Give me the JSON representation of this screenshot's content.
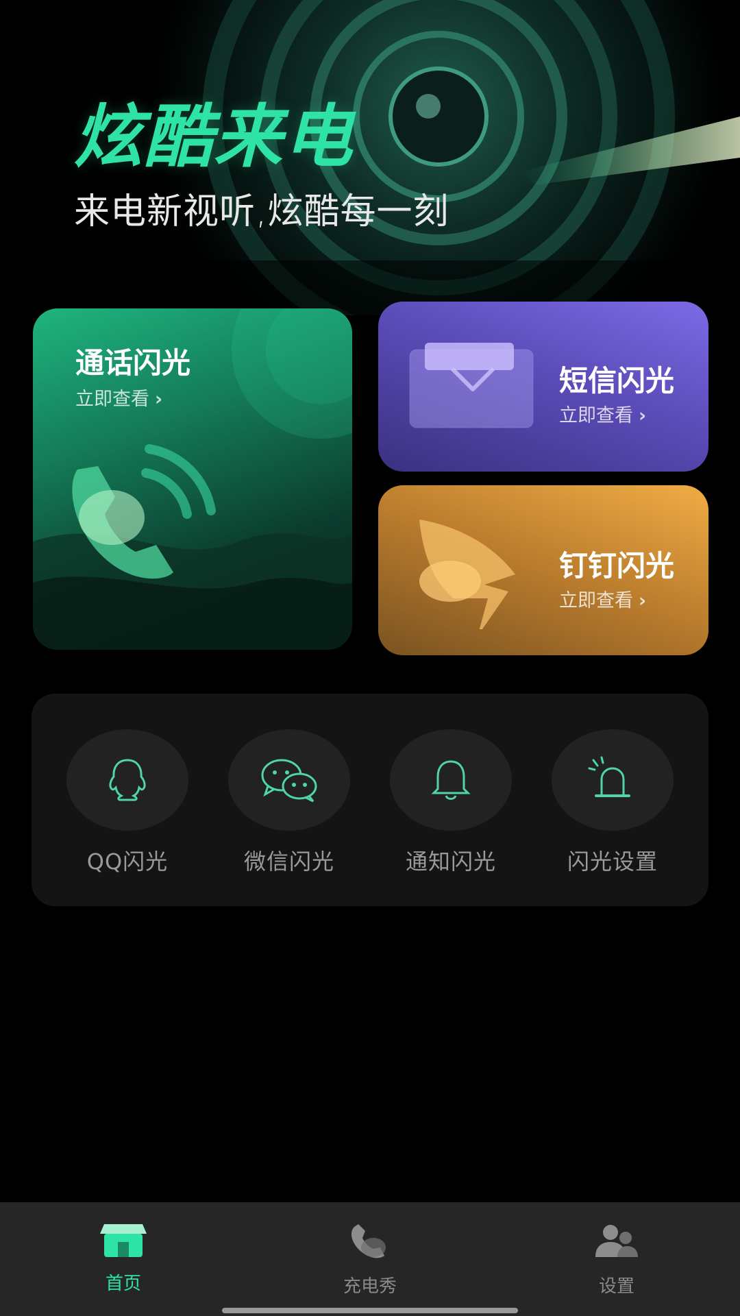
{
  "hero": {
    "title": "炫酷来电",
    "subtitle": "来电新视听,炫酷每一刻"
  },
  "cards": {
    "call": {
      "title": "通话闪光",
      "link": "立即查看",
      "icon": "phone-icon"
    },
    "sms": {
      "title": "短信闪光",
      "link": "立即查看",
      "icon": "envelope-icon"
    },
    "dingtalk": {
      "title": "钉钉闪光",
      "link": "立即查看",
      "icon": "dingtalk-icon"
    }
  },
  "shortcuts": [
    {
      "label": "QQ闪光",
      "icon": "qq-icon"
    },
    {
      "label": "微信闪光",
      "icon": "wechat-icon"
    },
    {
      "label": "通知闪光",
      "icon": "bell-icon"
    },
    {
      "label": "闪光设置",
      "icon": "alarm-light-icon"
    }
  ],
  "nav": {
    "items": [
      {
        "label": "首页",
        "icon": "home-icon",
        "active": true
      },
      {
        "label": "充电秀",
        "icon": "phone-handset-icon",
        "active": false
      },
      {
        "label": "设置",
        "icon": "users-icon",
        "active": false
      }
    ]
  },
  "colors": {
    "accent": "#2fe3a6",
    "call_card": "#147a58",
    "sms_card": "#5b4cb8",
    "dingtalk_card": "#f0ac45",
    "panel": "#141414",
    "nav_bg": "#262626"
  }
}
